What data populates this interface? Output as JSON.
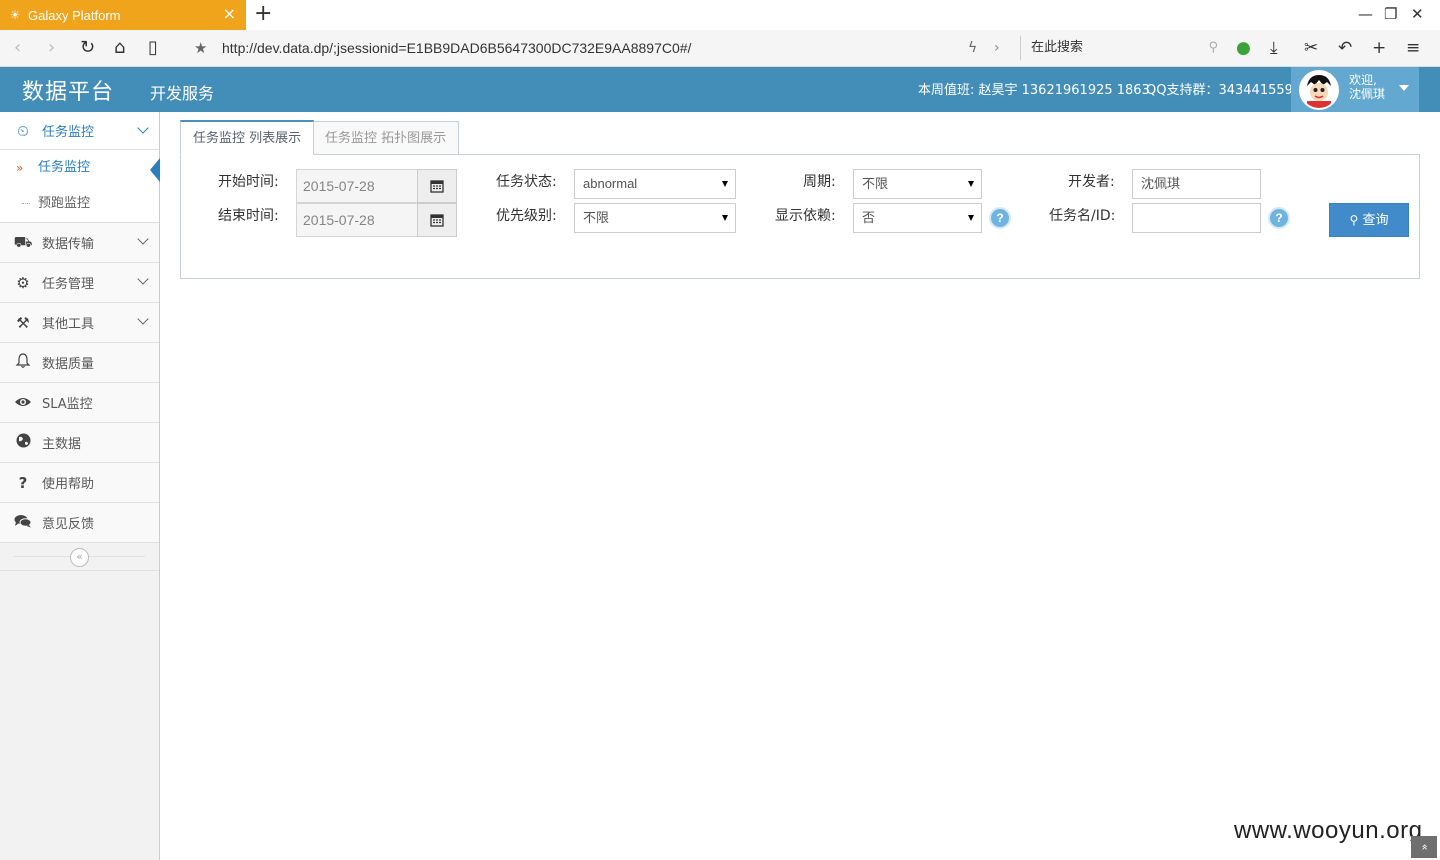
{
  "browser": {
    "tab_title": "Galaxy Platform",
    "tab_close": "×",
    "new_tab": "+",
    "url": "http://dev.data.dp/;jsessionid=E1BB9DAD6B5647300DC732E9AA8897C0#/",
    "search_placeholder": "在此搜索",
    "window_controls": {
      "minimize": "—",
      "restore": "❐",
      "close": "✕"
    }
  },
  "header": {
    "brand": "数据平台",
    "subtitle": "开发服务",
    "duty": "本周值班: 赵昊宇 13621961925 1863",
    "qq_support": "QQ支持群：343441559",
    "welcome_line1": "欢迎,",
    "welcome_line2": "沈佩琪"
  },
  "sidebar": {
    "items": [
      {
        "label": "任务监控",
        "icon": "dashboard-icon",
        "glyph": "⏲",
        "open": true,
        "children": [
          {
            "label": "任务监控",
            "active": true
          },
          {
            "label": "预跑监控",
            "active": false
          }
        ]
      },
      {
        "label": "数据传输",
        "icon": "truck-icon",
        "glyph": "⛟",
        "chevron": true
      },
      {
        "label": "任务管理",
        "icon": "gears-icon",
        "glyph": "⚙",
        "chevron": true
      },
      {
        "label": "其他工具",
        "icon": "gavel-icon",
        "glyph": "⚒",
        "chevron": true
      },
      {
        "label": "数据质量",
        "icon": "bell-icon",
        "glyph": "♫"
      },
      {
        "label": "SLA监控",
        "icon": "eye-icon",
        "glyph": "◉"
      },
      {
        "label": "主数据",
        "icon": "globe-icon",
        "glyph": "◍"
      },
      {
        "label": "使用帮助",
        "icon": "question-icon",
        "glyph": "?"
      },
      {
        "label": "意见反馈",
        "icon": "comments-icon",
        "glyph": "✉"
      }
    ],
    "collapse_glyph": "«"
  },
  "tabs": {
    "list_view": "任务监控 列表展示",
    "topology_view": "任务监控 拓扑图展示"
  },
  "form": {
    "start_time_label": "开始时间:",
    "start_time_value": "2015-07-28",
    "end_time_label": "结束时间:",
    "end_time_value": "2015-07-28",
    "task_status_label": "任务状态:",
    "task_status_value": "abnormal",
    "priority_label": "优先级别:",
    "priority_value": "不限",
    "period_label": "周期:",
    "period_value": "不限",
    "show_depend_label": "显示依赖:",
    "show_depend_value": "否",
    "developer_label": "开发者:",
    "developer_value": "沈佩琪",
    "task_name_label": "任务名/ID:",
    "task_name_value": "",
    "help_glyph": "?",
    "query_button": "查询"
  },
  "watermark": "www.wooyun.org",
  "scroll_top_glyph": "«"
}
